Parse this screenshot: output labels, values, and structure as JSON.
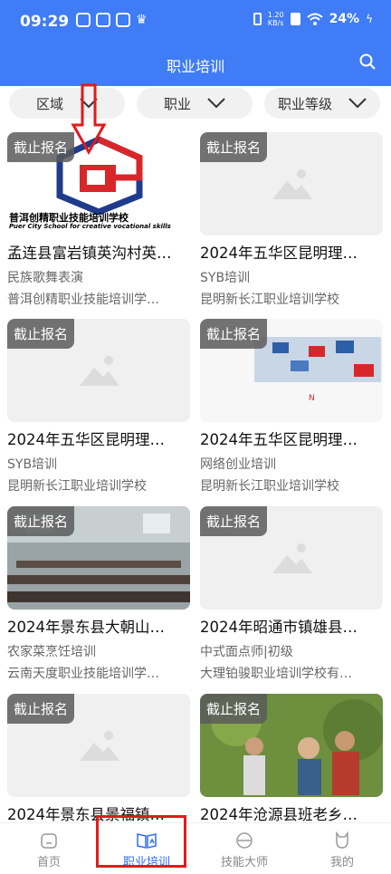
{
  "status": {
    "time": "09:29",
    "net_speed_top": "1.20",
    "net_speed_bottom": "KB/s",
    "battery": "24%"
  },
  "header": {
    "title": "职业培训"
  },
  "filters": [
    {
      "label": "区域"
    },
    {
      "label": "职业"
    },
    {
      "label": "职业等级"
    }
  ],
  "logo": {
    "name": "普洱创精职业技能培训学校",
    "en": "Puer City School for creative vocational skills"
  },
  "cards": [
    {
      "badge": "截止报名",
      "title": "孟连县富岩镇英沟村英…",
      "category": "民族歌舞表演",
      "school": "普洱创精职业技能培训学…"
    },
    {
      "badge": "截止报名",
      "title": "2024年五华区昆明理…",
      "category": "SYB培训",
      "school": "昆明新长江职业培训学校"
    },
    {
      "badge": "截止报名",
      "title": "2024年五华区昆明理…",
      "category": "SYB培训",
      "school": "昆明新长江职业培训学校"
    },
    {
      "badge": "截止报名",
      "title": "2024年五华区昆明理…",
      "category": "网络创业培训",
      "school": "昆明新长江职业培训学校"
    },
    {
      "badge": "截止报名",
      "title": "2024年景东县大朝山…",
      "category": "农家菜烹饪培训",
      "school": "云南天度职业技能培训学…"
    },
    {
      "badge": "截止报名",
      "title": "2024年昭通市镇雄县…",
      "category": "中式面点师|初级",
      "school": "大理铂骏职业培训学校有…"
    },
    {
      "badge": "截止报名",
      "title": "2024年景东县景福镇…",
      "category": "",
      "school": ""
    },
    {
      "badge": "截止报名",
      "title": "2024年沧源县班老乡…",
      "category": "",
      "school": ""
    }
  ],
  "tabs": [
    {
      "label": "首页"
    },
    {
      "label": "职业培训"
    },
    {
      "label": "技能大师"
    },
    {
      "label": "我的"
    }
  ],
  "colors": {
    "header": "#3f7cf5",
    "active_tab": "#2e6df0",
    "highlight": "#e01b1b"
  }
}
